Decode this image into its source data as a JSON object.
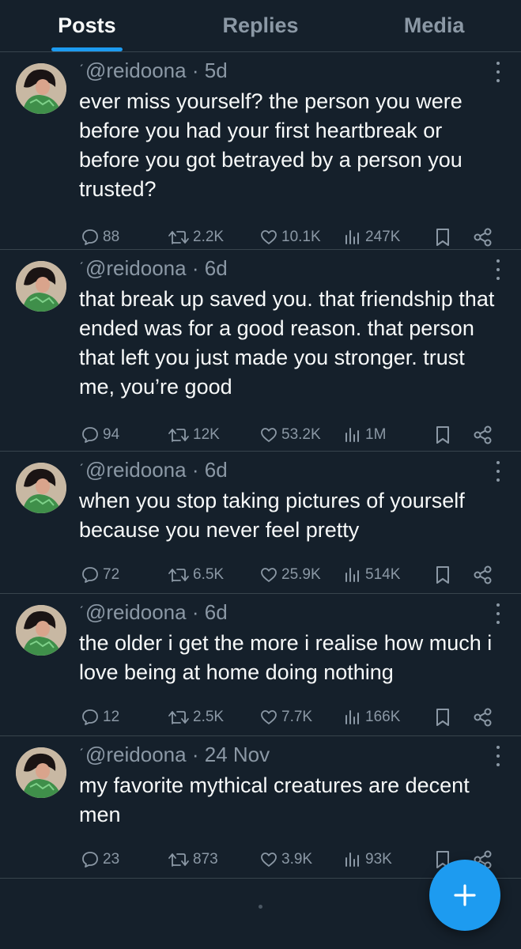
{
  "tabs": [
    {
      "label": "Posts",
      "active": true
    },
    {
      "label": "Replies",
      "active": false
    },
    {
      "label": "Media",
      "active": false
    }
  ],
  "posts": [
    {
      "mark": "ˊ",
      "handle": "@reidoona",
      "separator": "·",
      "time": "5d",
      "text": "ever miss yourself? the person you were before you had your first heartbreak or before you got betrayed by a person you trusted?",
      "replies": "88",
      "reposts": "2.2K",
      "likes": "10.1K",
      "views": "247K"
    },
    {
      "mark": "ˊ",
      "handle": "@reidoona",
      "separator": "·",
      "time": "6d",
      "text": "that break up saved you. that friendship that ended was for a good reason. that person that left you just made you stronger. trust me, you’re good",
      "replies": "94",
      "reposts": "12K",
      "likes": "53.2K",
      "views": "1M"
    },
    {
      "mark": "ˊ",
      "handle": "@reidoona",
      "separator": "·",
      "time": "6d",
      "text": "when you stop taking pictures of yourself because you never feel pretty",
      "replies": "72",
      "reposts": "6.5K",
      "likes": "25.9K",
      "views": "514K"
    },
    {
      "mark": "ˊ",
      "handle": "@reidoona",
      "separator": "·",
      "time": "6d",
      "text": "the older i get the more i realise how much i love being at home doing nothing",
      "replies": "12",
      "reposts": "2.5K",
      "likes": "7.7K",
      "views": "166K"
    },
    {
      "mark": "ˊ",
      "handle": "@reidoona",
      "separator": "·",
      "time": "24 Nov",
      "text": "my favorite mythical creatures are decent men",
      "replies": "23",
      "reposts": "873",
      "likes": "3.9K",
      "views": "93K"
    }
  ],
  "icons": {
    "reply": "speech-bubble-icon",
    "repost": "repost-arrows-icon",
    "like": "heart-icon",
    "views": "bar-chart-icon",
    "bookmark": "bookmark-icon",
    "share": "share-icon",
    "more": "more-vertical-icon",
    "compose": "plus-icon"
  },
  "colors": {
    "background": "#15202b",
    "accent": "#1d9bf0",
    "text": "#f7f9f9",
    "secondary_text": "#8b98a5",
    "divider": "#38444d"
  }
}
